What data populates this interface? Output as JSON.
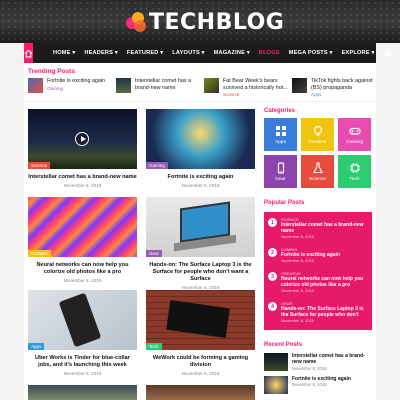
{
  "brand": {
    "name": "TECHBLOG"
  },
  "nav": {
    "items": [
      {
        "label": "HOME ▾",
        "active": false
      },
      {
        "label": "HEADERS ▾",
        "active": false
      },
      {
        "label": "FEATURED ▾",
        "active": false
      },
      {
        "label": "LAYOUTS ▾",
        "active": false
      },
      {
        "label": "MAGAZINE ▾",
        "active": false
      },
      {
        "label": "BLOGS",
        "active": true
      },
      {
        "label": "MEGA POSTS ▾",
        "active": false
      },
      {
        "label": "EXPLORE ▾",
        "active": false
      }
    ],
    "accent": "#ff1a6a"
  },
  "trending": {
    "title": "Trending Posts",
    "items": [
      {
        "title": "Fortnite is exciting again",
        "category": "Gaming"
      },
      {
        "title": "Interstellar comet has a brand-new name",
        "category": ""
      },
      {
        "title": "Fat Bear Week's bears survived a historically hot...",
        "category": "Science"
      },
      {
        "title": "TikTok fights back against (BS) propaganda",
        "category": "Apps"
      }
    ]
  },
  "posts": [
    {
      "title": "Interstellar comet has a brand-new name",
      "date": "November 8, 2019",
      "category": "Science",
      "catColor": "#e84c3d"
    },
    {
      "title": "Fortnite is exciting again",
      "date": "November 8, 2019",
      "category": "Gaming",
      "catColor": "#9b59b6"
    },
    {
      "title": "Neural networks can now help you colorize old photos like a pro",
      "date": "November 8, 2019",
      "category": "Creative",
      "catColor": "#f1c40f"
    },
    {
      "title": "Hands-on: The Surface Laptop 3 is the Surface for people who don't want a Surface",
      "date": "November 8, 2019",
      "category": "Gear",
      "catColor": "#9b59b6"
    },
    {
      "title": "Uber Works is Tinder for blue-collar jobs, and it's launching this week",
      "date": "November 8, 2019",
      "category": "Apps",
      "catColor": "#3498db"
    },
    {
      "title": "WeWork could be forming a gaming division",
      "date": "November 8, 2019",
      "category": "Tech",
      "catColor": "#2ecc71"
    }
  ],
  "categories": {
    "title": "Categories",
    "items": [
      {
        "label": "Apps",
        "color": "#3b7ddd",
        "icon": "grid-icon"
      },
      {
        "label": "Creative",
        "color": "#f1c40f",
        "icon": "bulb-icon"
      },
      {
        "label": "Gaming",
        "color": "#e84cb0",
        "icon": "gamepad-icon"
      },
      {
        "label": "Gear",
        "color": "#8e44ad",
        "icon": "phone-icon"
      },
      {
        "label": "Science",
        "color": "#e74c3c",
        "icon": "flask-icon"
      },
      {
        "label": "Tech",
        "color": "#2ecc71",
        "icon": "chip-icon"
      }
    ]
  },
  "popular": {
    "title": "Popular Posts",
    "items": [
      {
        "num": "1",
        "category": "SCIENCE",
        "title": "Interstellar comet has a brand-new name",
        "date": "November 8, 2019"
      },
      {
        "num": "2",
        "category": "GAMING",
        "title": "Fortnite is exciting again",
        "date": "November 8, 2019"
      },
      {
        "num": "3",
        "category": "CREATIVE",
        "title": "Neural networks can now help you colorize old photos like a pro",
        "date": "November 8, 2019"
      },
      {
        "num": "4",
        "category": "GEAR",
        "title": "Hands-on: The Surface Laptop 3 is the Surface for people who don't",
        "date": "November 8, 2019"
      }
    ]
  },
  "recent": {
    "title": "Recent Posts",
    "items": [
      {
        "title": "Interstellar comet has a brand-new name",
        "date": "November 8, 2019"
      },
      {
        "title": "Fortnite is exciting again",
        "date": "November 8, 2019"
      }
    ]
  }
}
